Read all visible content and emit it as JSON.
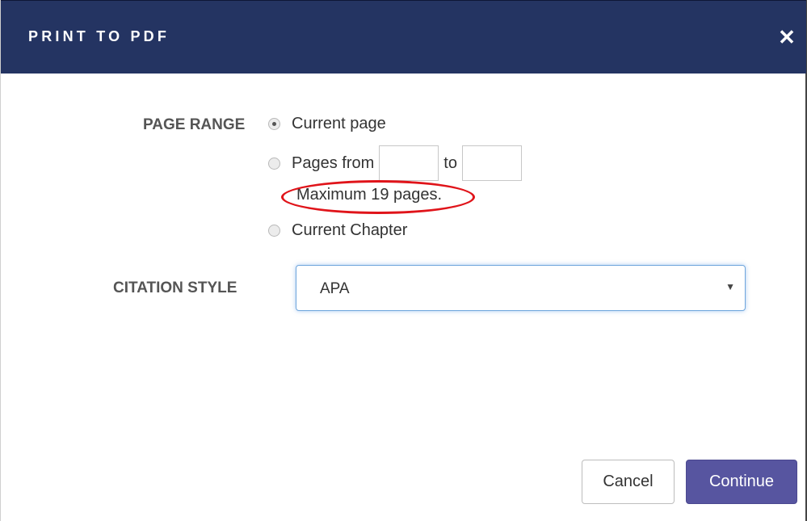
{
  "dialog": {
    "title": "PRINT TO PDF",
    "close_symbol": "✕",
    "close_icon": "close-icon"
  },
  "page_range": {
    "label": "PAGE RANGE",
    "options": [
      {
        "label": "Current page",
        "checked": true
      },
      {
        "label": "Pages from",
        "checked": false
      },
      {
        "label": "Current Chapter",
        "checked": false
      }
    ],
    "from_value": "",
    "to_label": "to",
    "to_value": "",
    "max_note": "Maximum 19 pages."
  },
  "citation": {
    "label": "CITATION STYLE",
    "selected": "APA",
    "caret": "▼"
  },
  "buttons": {
    "cancel": "Cancel",
    "continue": "Continue"
  },
  "colors": {
    "header": "#243462",
    "primary_button": "#5755a0",
    "highlight": "#e0141a"
  }
}
